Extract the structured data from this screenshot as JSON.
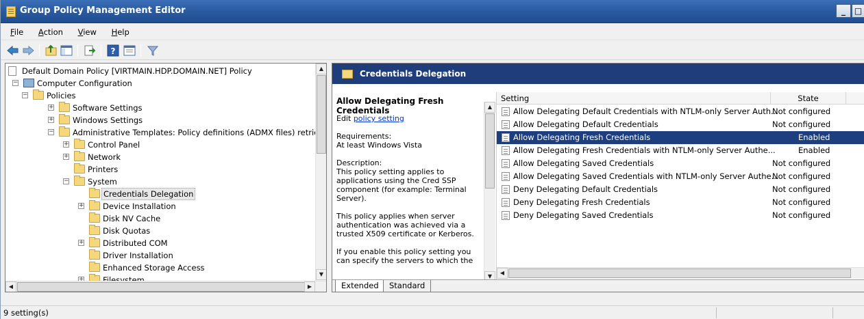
{
  "window": {
    "title": "Group Policy Management Editor",
    "controls": {
      "minimize": "_",
      "restore": "□"
    }
  },
  "menu": [
    {
      "label": "File",
      "accel": "F",
      "rest": "ile"
    },
    {
      "label": "Action",
      "accel": "A",
      "rest": "ction"
    },
    {
      "label": "View",
      "accel": "V",
      "rest": "iew"
    },
    {
      "label": "Help",
      "accel": "H",
      "rest": "elp"
    }
  ],
  "toolbar": {
    "icons": [
      "back-arrow-icon",
      "forward-arrow-icon",
      "up-folder-icon",
      "show-hide-tree-icon",
      "export-list-icon",
      "help-icon",
      "properties-icon",
      "filter-icon"
    ]
  },
  "tree": {
    "root": "Default Domain Policy [VIRTMAIN.HDP.DOMAIN.NET] Policy",
    "computer_configuration": "Computer Configuration",
    "policies": "Policies",
    "software_settings": "Software Settings",
    "windows_settings": "Windows Settings",
    "admin_templates": "Administrative Templates: Policy definitions (ADMX files) retrieved",
    "control_panel": "Control Panel",
    "network": "Network",
    "printers": "Printers",
    "system": "System",
    "credentials_delegation": "Credentials Delegation",
    "device_installation": "Device Installation",
    "disk_nv_cache": "Disk NV Cache",
    "disk_quotas": "Disk Quotas",
    "distributed_com": "Distributed COM",
    "driver_installation": "Driver Installation",
    "enhanced_storage_access": "Enhanced Storage Access",
    "filesystem": "Filesystem"
  },
  "right": {
    "header_title": "Credentials Delegation",
    "desc": {
      "title": "Allow Delegating Fresh Credentials",
      "edit_prefix": "Edit ",
      "edit_link": "policy setting",
      "requirements_label": "Requirements:",
      "requirements_value": "At least Windows Vista",
      "description_label": "Description:",
      "description_text": "This policy setting applies to applications using the Cred SSP component (for example: Terminal Server).",
      "para2": "This policy applies when server authentication was achieved via a trusted X509 certificate or Kerberos.",
      "para3": "If you enable this policy setting you can specify the servers to which the"
    },
    "columns": {
      "setting": "Setting",
      "state": "State"
    },
    "rows": [
      {
        "name": "Allow Delegating Default Credentials with NTLM-only Server Auth...",
        "state": "Not configured"
      },
      {
        "name": "Allow Delegating Default Credentials",
        "state": "Not configured"
      },
      {
        "name": "Allow Delegating Fresh Credentials",
        "state": "Enabled",
        "selected": true
      },
      {
        "name": "Allow Delegating Fresh Credentials with NTLM-only Server Authe...",
        "state": "Enabled"
      },
      {
        "name": "Allow Delegating Saved Credentials",
        "state": "Not configured"
      },
      {
        "name": "Allow Delegating Saved Credentials with NTLM-only Server Authe...",
        "state": "Not configured"
      },
      {
        "name": "Deny Delegating Default Credentials",
        "state": "Not configured"
      },
      {
        "name": "Deny Delegating Fresh Credentials",
        "state": "Not configured"
      },
      {
        "name": "Deny Delegating Saved Credentials",
        "state": "Not configured"
      }
    ],
    "tabs": {
      "extended": "Extended",
      "standard": "Standard"
    }
  },
  "status": {
    "text": "9 setting(s)"
  },
  "colors": {
    "title_bar": "#2a5aa0",
    "header_band": "#1f3d7a",
    "selection": "#1e3f7f"
  }
}
